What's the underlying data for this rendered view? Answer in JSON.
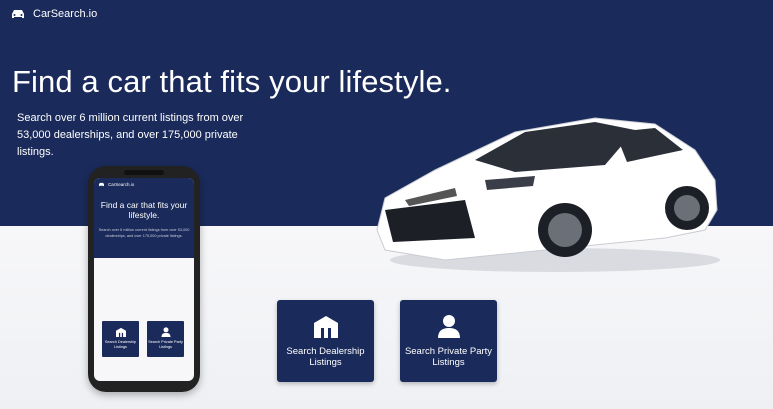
{
  "brand": {
    "name": "CarSearch.io"
  },
  "hero": {
    "headline": "Find a car that fits your lifestyle.",
    "subtext": "Search over 6 million current listings from over 53,000 dealerships, and over 175,000 private listings."
  },
  "cta": {
    "dealership_label": "Search Dealership Listings",
    "dealership_icon": "building-icon",
    "private_label": "Search Private Party Listings",
    "private_icon": "person-icon"
  },
  "phone": {
    "brand": "CarSearch.io",
    "headline": "Find a car that fits your lifestyle.",
    "subtext": "Search over 6 million current listings from over 53,000 dealerships, and over 175,000 private listings.",
    "dealership_label": "Search Dealership Listings",
    "private_label": "Search Private Party Listings"
  },
  "colors": {
    "navy": "#1a2a5a",
    "background": "#f4f5f8",
    "text_light": "#ffffff"
  }
}
